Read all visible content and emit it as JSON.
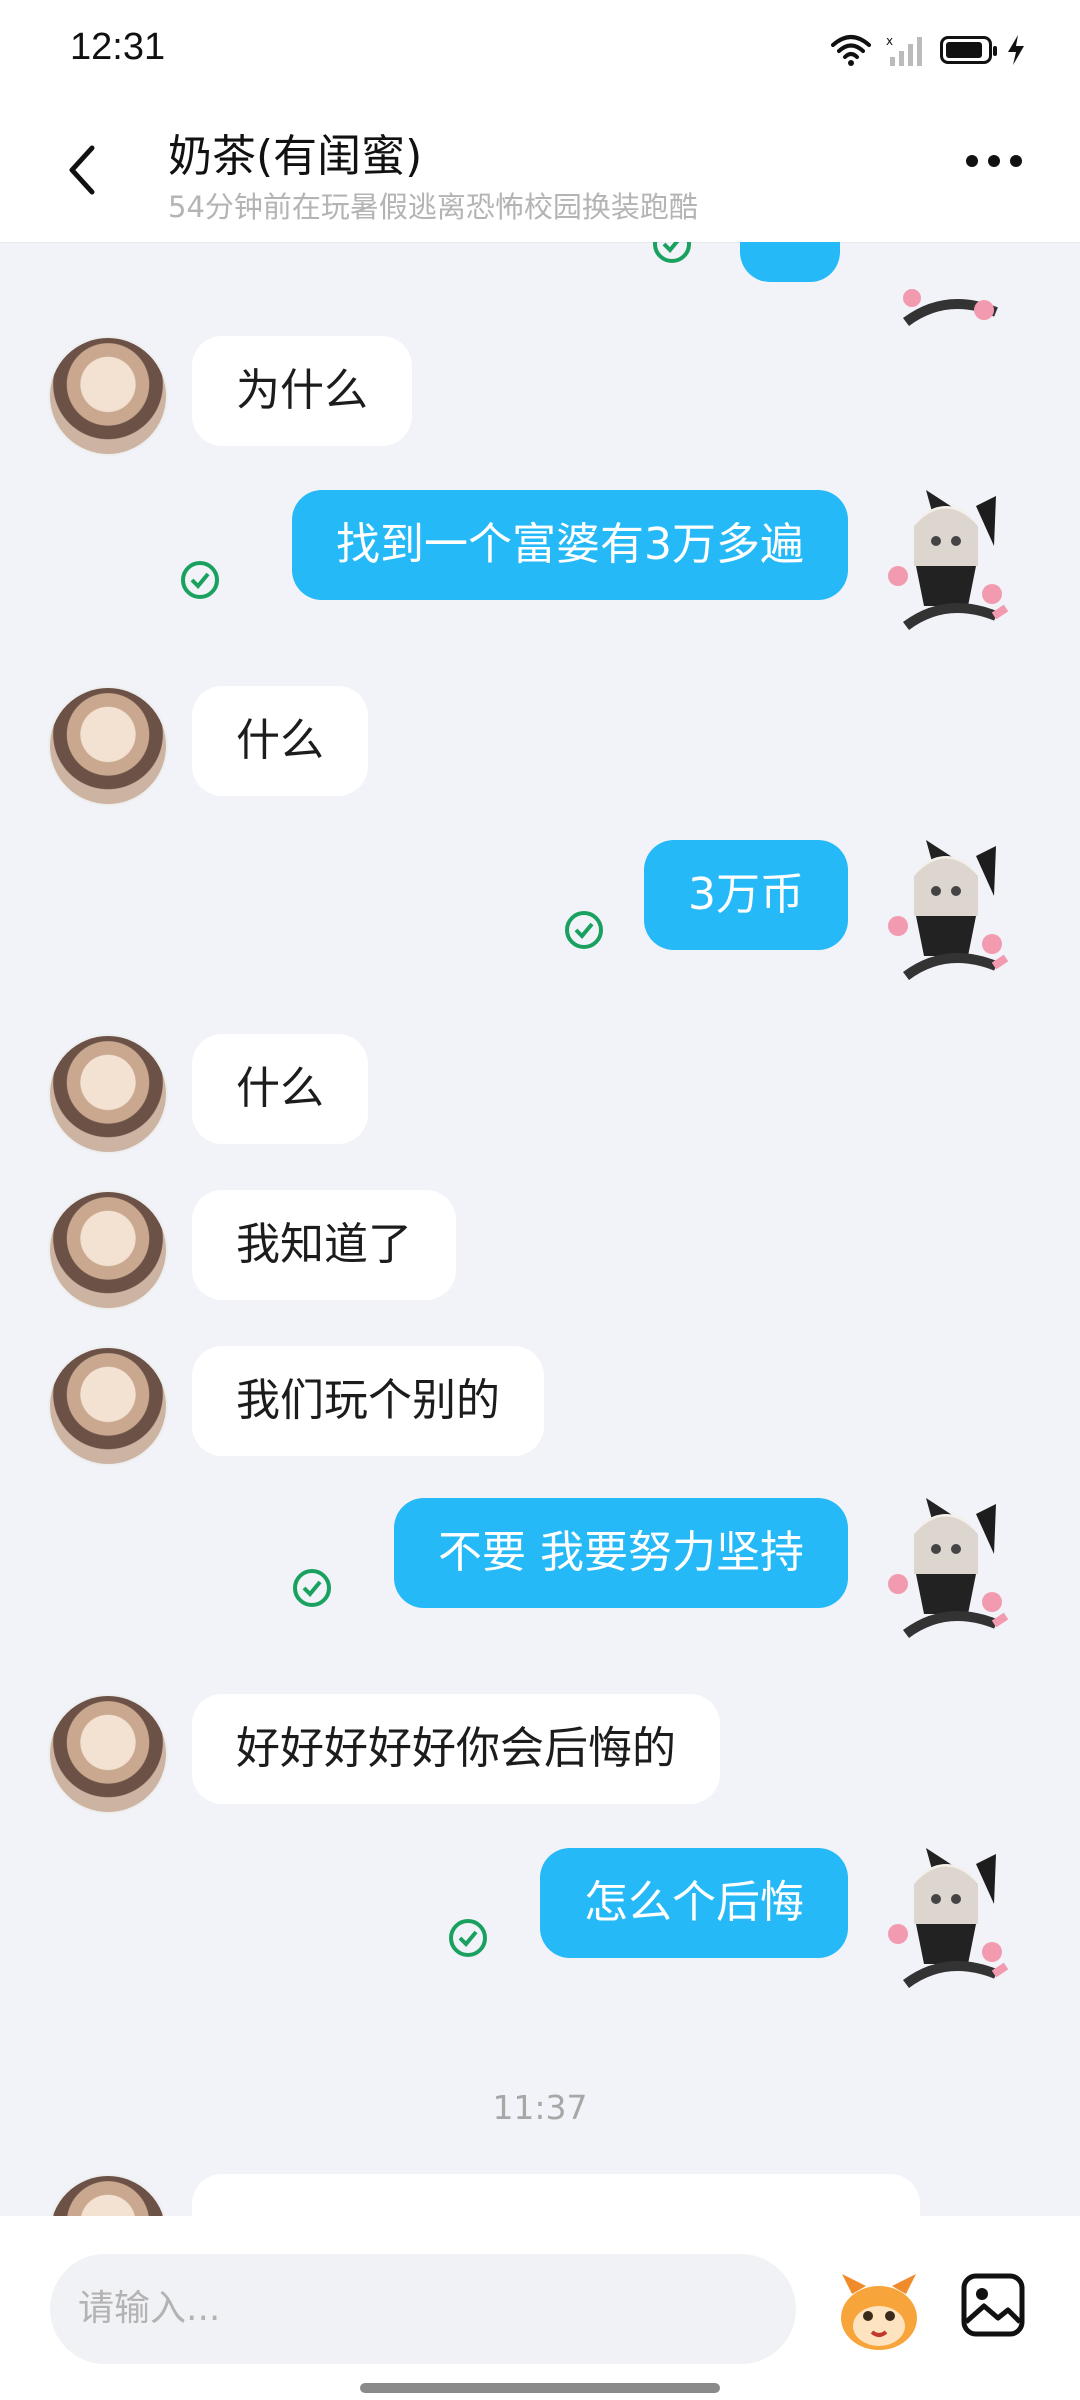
{
  "status_bar": {
    "time": "12:31"
  },
  "header": {
    "title": "奶茶(有闺蜜)",
    "subtitle": "54分钟前在玩暑假逃离恐怖校园换装跑酷"
  },
  "messages": [
    {
      "side": "left",
      "text": "为什么"
    },
    {
      "side": "right",
      "text": "找到一个富婆有3万多遍"
    },
    {
      "side": "left",
      "text": "什么"
    },
    {
      "side": "right",
      "text": "3万币"
    },
    {
      "side": "left",
      "text": "什么"
    },
    {
      "side": "left",
      "text": "我知道了"
    },
    {
      "side": "left",
      "text": "我们玩个别的"
    },
    {
      "side": "right",
      "text": "不要 我要努力坚持"
    },
    {
      "side": "left",
      "text": "好好好好好你会后悔的"
    },
    {
      "side": "right",
      "text": "怎么个后悔"
    }
  ],
  "time_separator": "11:37",
  "input": {
    "placeholder": "请输入..."
  },
  "colors": {
    "accent": "#25b9f7",
    "read_check": "#1aa15f"
  }
}
